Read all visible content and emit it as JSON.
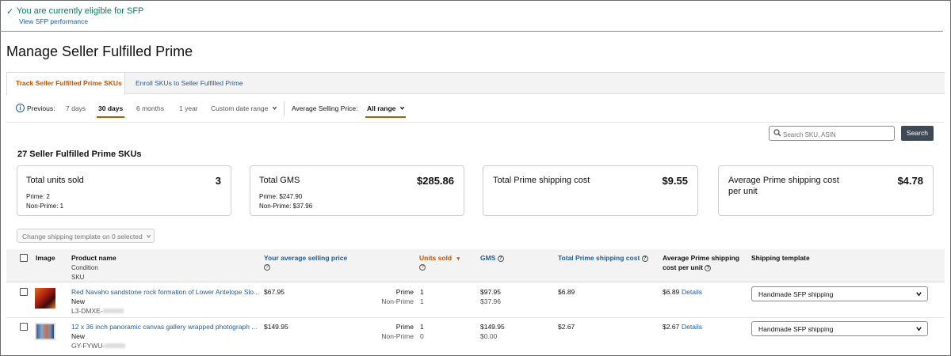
{
  "banner": {
    "check": "✓",
    "eligibility_text": "You are currently eligible for SFP",
    "performance_link": "View SFP performance"
  },
  "page_title": "Manage Seller Fulfilled Prime",
  "tabs": [
    {
      "label": "Track Seller Fulfilled Prime SKUs",
      "active": true
    },
    {
      "label": "Enroll SKUs to Seller Fulfilled Prime",
      "active": false
    }
  ],
  "filters": {
    "info_glyph": "i",
    "previous_label": "Previous:",
    "periods": [
      "7 days",
      "30 days",
      "6 months",
      "1 year",
      "Custom date range"
    ],
    "selected_period": "30 days",
    "asp_label": "Average Selling Price:",
    "asp_value": "All range"
  },
  "search": {
    "placeholder": "Search SKU, ASIN",
    "button": "Search"
  },
  "sku_count_heading": "27 Seller Fulfilled Prime SKUs",
  "metrics": [
    {
      "label": "Total units sold",
      "value": "3",
      "sub1": "Prime: 2",
      "sub2": "Non-Prime: 1"
    },
    {
      "label": "Total GMS",
      "value": "$285.86",
      "sub1": "Prime: $247.90",
      "sub2": "Non-Prime: $37.96"
    },
    {
      "label": "Total Prime shipping cost",
      "value": "$9.55"
    },
    {
      "label": "Average Prime shipping cost per unit",
      "value": "$4.78"
    }
  ],
  "bulk_action": "Change shipping template on 0 selected",
  "table": {
    "headers": {
      "image": "Image",
      "product_name": "Product name",
      "condition": "Condition",
      "sku": "SKU",
      "avg_price": "Your average selling price",
      "units_sold": "Units sold",
      "sort_glyph": "▾",
      "help_glyph": "?",
      "gms": "GMS",
      "total_ship": "Total Prime shipping cost",
      "avg_ship_line1": "Average Prime shipping",
      "avg_ship_line2": "cost per unit",
      "template": "Shipping template"
    },
    "rows": [
      {
        "name": "Red Navaho sandstone rock formation of Lower Antelope Slo...",
        "condition": "New",
        "sku": "L3-DMXE-",
        "price": "$67.95",
        "prime_label": "Prime",
        "nonprime_label": "Non-Prime",
        "units_prime": "1",
        "units_nonprime": "1",
        "gms_prime": "$97.95",
        "gms_nonprime": "$37.96",
        "total_ship": "$6.89",
        "avg_ship": "$6.89",
        "details": "Details",
        "template": "Handmade SFP shipping"
      },
      {
        "name": "12 x 36 inch panoramic canvas gallery wrapped photograph ...",
        "condition": "New",
        "sku": "GY-FYWU-",
        "price": "$149.95",
        "prime_label": "Prime",
        "nonprime_label": "Non-Prime",
        "units_prime": "1",
        "units_nonprime": "0",
        "gms_prime": "$149.95",
        "gms_nonprime": "$0.00",
        "total_ship": "$2.67",
        "avg_ship": "$2.67",
        "details": "Details",
        "template": "Handmade SFP shipping"
      }
    ]
  }
}
